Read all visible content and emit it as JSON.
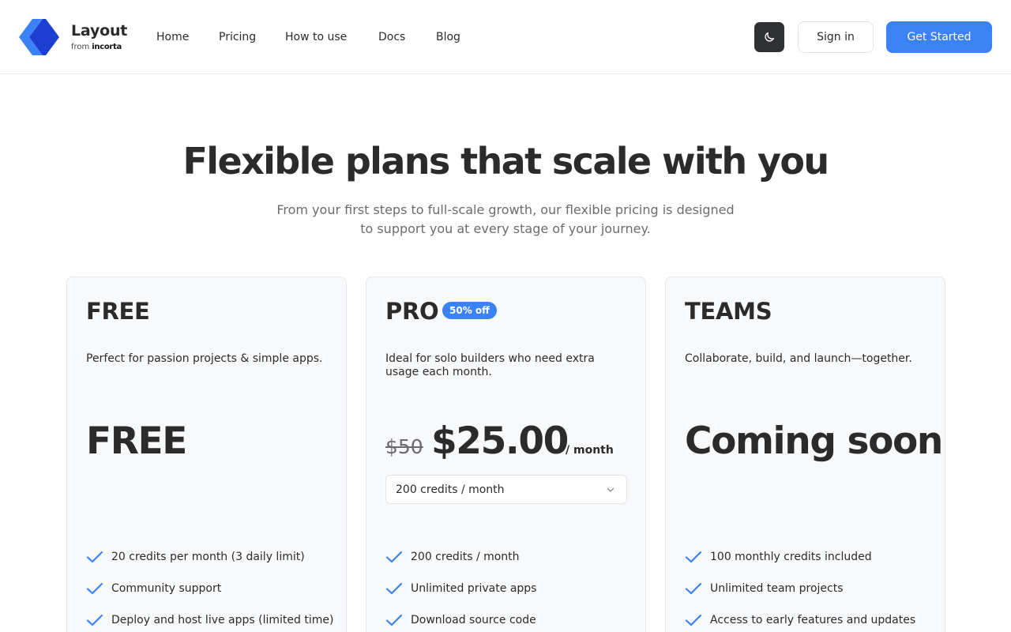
{
  "header": {
    "brand_name": "Layout",
    "brand_from": "from",
    "brand_company": "incorta",
    "nav": [
      "Home",
      "Pricing",
      "How to use",
      "Docs",
      "Blog"
    ],
    "theme_toggle_icon": "moon-icon",
    "sign_in": "Sign in",
    "get_started": "Get Started",
    "accent_color": "#3b82f6"
  },
  "hero": {
    "title": "Flexible plans that scale with you",
    "subtitle_line1": "From your first steps to full-scale growth, our flexible pricing is designed",
    "subtitle_line2": "to support you at every stage of your journey."
  },
  "plans": [
    {
      "name": "FREE",
      "description": "Perfect for passion projects & simple apps.",
      "price": "FREE",
      "features": [
        "20 credits per month (3 daily limit)",
        "Community support",
        "Deploy and host live apps (limited time)"
      ]
    },
    {
      "name": "PRO",
      "badge": "50% off",
      "description": "Ideal for solo builders who need extra usage each month.",
      "old_price": "$50",
      "price": "$25.00",
      "period": "/ month",
      "credits_select": "200 credits / month",
      "features": [
        "200 credits / month",
        "Unlimited private apps",
        "Download source code"
      ]
    },
    {
      "name": "TEAMS",
      "description": "Collaborate, build, and launch—together.",
      "price": "Coming soon",
      "features": [
        "100 monthly credits included",
        "Unlimited team projects",
        "Access to early features and updates"
      ]
    }
  ]
}
